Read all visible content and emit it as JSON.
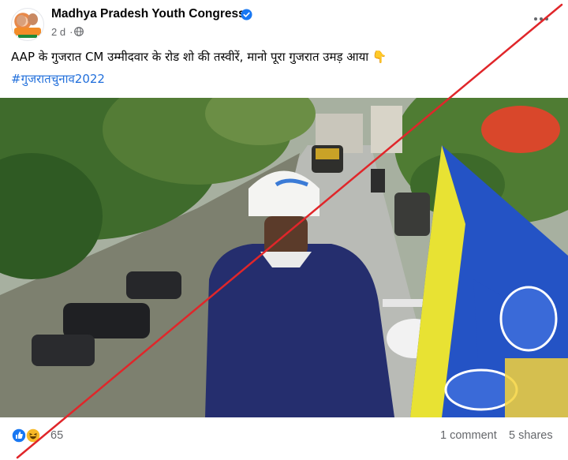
{
  "post": {
    "page_name": "Madhya Pradesh Youth Congress",
    "timestamp": "2 d",
    "privacy_icon": "globe-icon",
    "verified_icon": "verified-badge-icon",
    "caption": "AAP के गुजरात CM उम्मीदवार के रोड शो की तस्वीरें, मानो पूरा गुजरात उमड़ आया 👇",
    "hashtag": "#गुजरातचुनाव2022",
    "media": {
      "type": "video-frame"
    }
  },
  "footer": {
    "reaction_icons": [
      "like-icon",
      "haha-icon"
    ],
    "reaction_count": "65",
    "comments_label": "1 comment",
    "shares_label": "5 shares"
  },
  "overlay": {
    "type": "red-cross-mark",
    "color": "#e0262a"
  },
  "colors": {
    "link": "#216fdb",
    "secondary_text": "#65676b",
    "verified": "#1877f2"
  }
}
